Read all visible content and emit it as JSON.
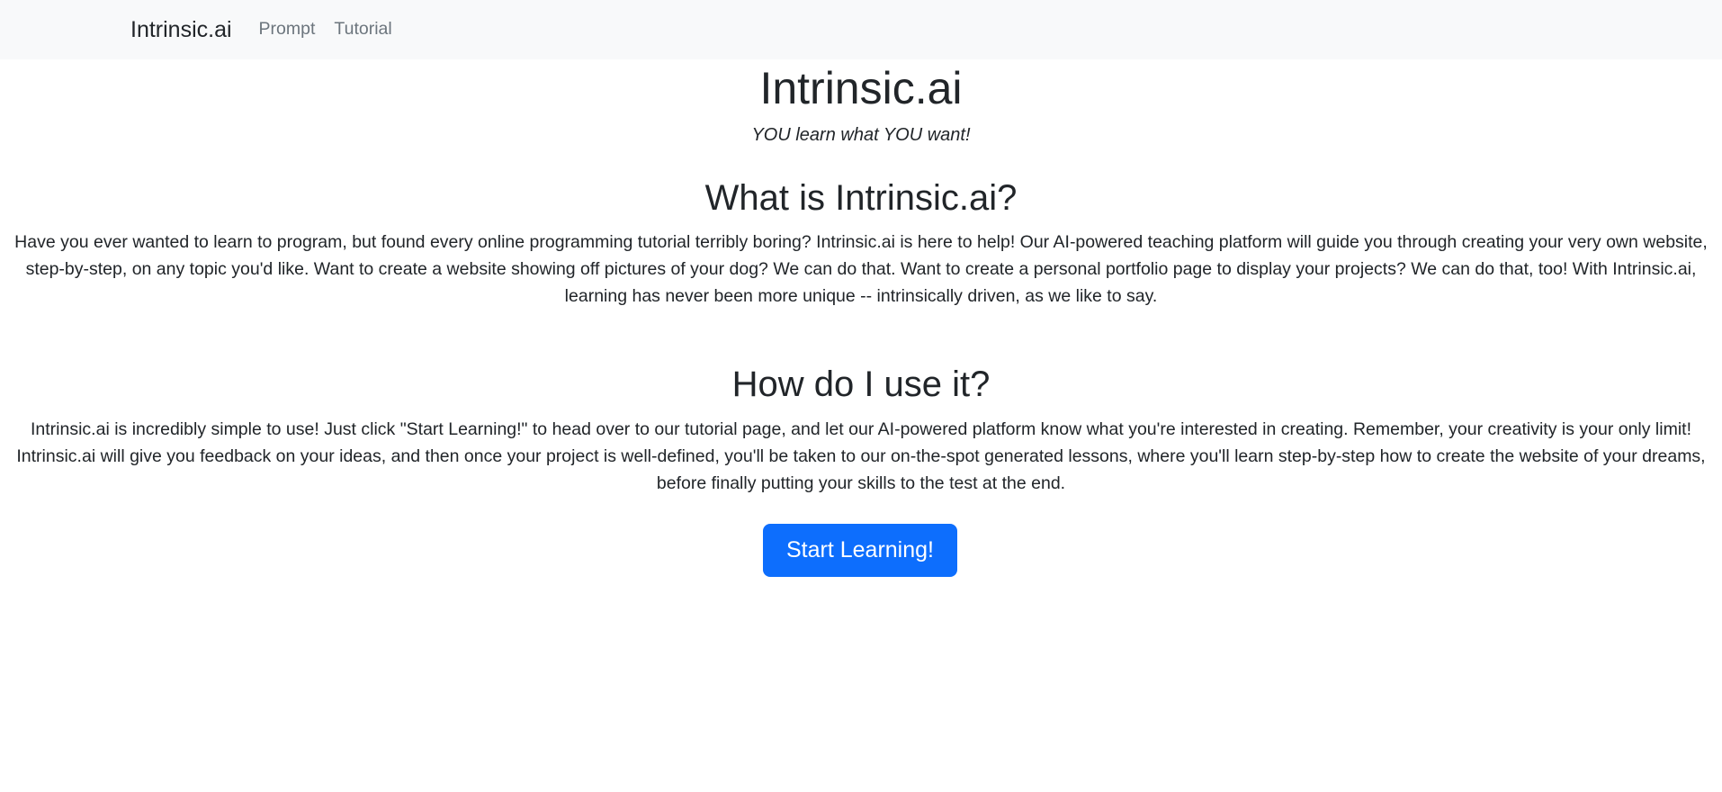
{
  "navbar": {
    "brand": "Intrinsic.ai",
    "links": [
      "Prompt",
      "Tutorial"
    ]
  },
  "hero": {
    "title": "Intrinsic.ai",
    "tagline": "YOU learn what YOU want!"
  },
  "sections": [
    {
      "heading": "What is Intrinsic.ai?",
      "text": "Have you ever wanted to learn to program, but found every online programming tutorial terribly boring? Intrinsic.ai is here to help! Our AI-powered teaching platform will guide you through creating your very own website, step-by-step, on any topic you'd like. Want to create a website showing off pictures of your dog? We can do that. Want to create a personal portfolio page to display your projects? We can do that, too! With Intrinsic.ai, learning has never been more unique -- intrinsically driven, as we like to say."
    },
    {
      "heading": "How do I use it?",
      "text": "Intrinsic.ai is incredibly simple to use! Just click \"Start Learning!\" to head over to our tutorial page, and let our AI-powered platform know what you're interested in creating. Remember, your creativity is your only limit! Intrinsic.ai will give you feedback on your ideas, and then once your project is well-defined, you'll be taken to our on-the-spot generated lessons, where you'll learn step-by-step how to create the website of your dreams, before finally putting your skills to the test at the end."
    }
  ],
  "cta": {
    "label": "Start Learning!"
  },
  "colors": {
    "navbar_bg": "#f8f9fa",
    "primary": "#0d6efd",
    "text": "#212529",
    "nav_link": "#6c757d"
  }
}
